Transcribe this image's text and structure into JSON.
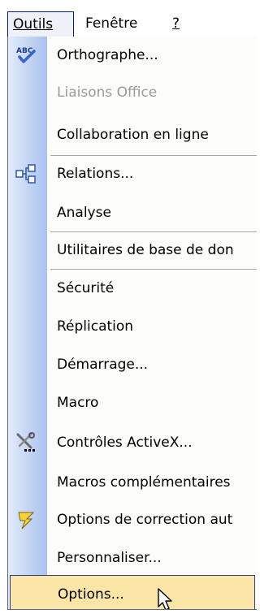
{
  "menubar": {
    "outils": "Outils",
    "fenetre": "Fenêtre",
    "help": "?"
  },
  "menu": {
    "items": [
      {
        "label": "Orthographe...",
        "icon": "spelling-check-icon",
        "enabled": true
      },
      {
        "label": "Liaisons Office",
        "enabled": false
      },
      {
        "label": "Collaboration en ligne",
        "enabled": true
      },
      {
        "label": "Relations...",
        "icon": "relationships-icon",
        "enabled": true
      },
      {
        "label": "Analyse",
        "enabled": true
      },
      {
        "label": "Utilitaires de base de don",
        "enabled": true
      },
      {
        "label": "Sécurité",
        "enabled": true
      },
      {
        "label": "Réplication",
        "enabled": true
      },
      {
        "label": "Démarrage...",
        "enabled": true
      },
      {
        "label": "Macro",
        "enabled": true
      },
      {
        "label": "Contrôles ActiveX...",
        "icon": "activex-controls-icon",
        "enabled": true
      },
      {
        "label": "Macros complémentaires",
        "enabled": true
      },
      {
        "label": "Options de correction aut",
        "icon": "autocorrect-icon",
        "enabled": true
      },
      {
        "label": "Personnaliser...",
        "enabled": true
      },
      {
        "label": "Options...",
        "enabled": true,
        "selected": true
      }
    ]
  },
  "colors": {
    "highlight_fill": "#fbe6a8",
    "highlight_border": "#2a3f86",
    "gutter_light": "#e3ebfb",
    "gutter_dark": "#a9c2ee"
  }
}
